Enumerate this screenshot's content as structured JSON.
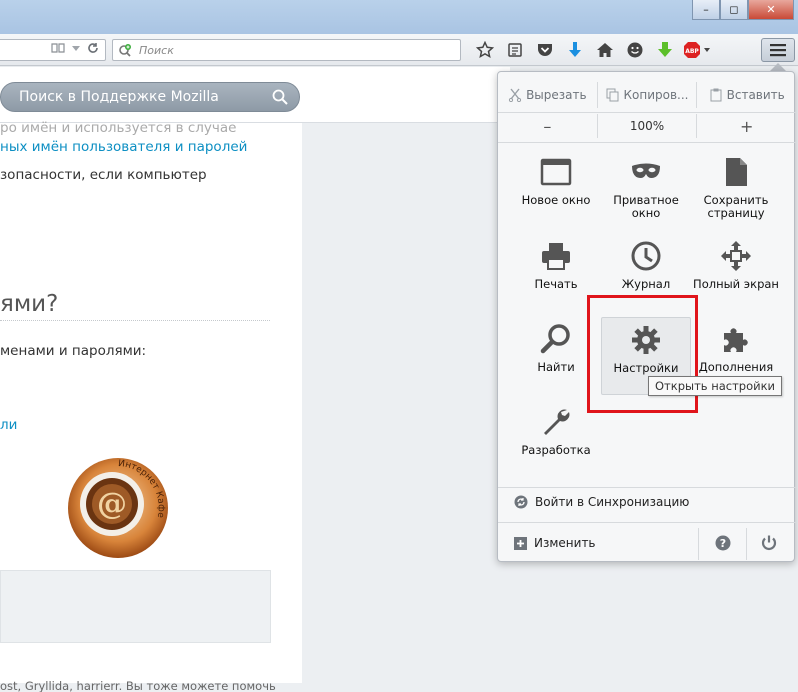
{
  "browser": {
    "search_placeholder": "Поиск",
    "window_buttons": {
      "minimize": "–",
      "maximize": "◻",
      "close": "✕"
    }
  },
  "page": {
    "support_search_placeholder": "Поиск в Поддержке Mozilla",
    "line1": "ро имён и используется в случае",
    "line2_link": "ных имён пользователя и паролей",
    "line3": "зопасности, если компьютер",
    "heading": "ями?",
    "line4": "менами и паролями:",
    "line5_link": "ли",
    "coffee_text": "Интернет Кафе",
    "contributors": "ost, Gryllida, harrierr. Вы тоже можете помочь"
  },
  "menu": {
    "edit": {
      "cut": "Вырезать",
      "copy": "Копиров...",
      "paste": "Вставить"
    },
    "zoom": {
      "minus": "–",
      "level": "100%",
      "plus": "+"
    },
    "items": [
      {
        "label": "Новое окно",
        "icon": "new-window-icon"
      },
      {
        "label": "Приватное окно",
        "icon": "private-mask-icon"
      },
      {
        "label": "Сохранить страницу",
        "icon": "save-page-icon"
      },
      {
        "label": "Печать",
        "icon": "printer-icon"
      },
      {
        "label": "Журнал",
        "icon": "clock-icon"
      },
      {
        "label": "Полный экран",
        "icon": "fullscreen-icon"
      },
      {
        "label": "Найти",
        "icon": "magnifier-icon"
      },
      {
        "label": "Настройки",
        "icon": "gear-icon"
      },
      {
        "label": "Дополнения",
        "icon": "puzzle-icon"
      },
      {
        "label": "Разработка",
        "icon": "wrench-icon"
      }
    ],
    "sync": "Войти в Синхронизацию",
    "customize": "Изменить",
    "tooltip": "Открыть настройки"
  },
  "colors": {
    "highlight": "#e0151b",
    "link": "#0d8fc3"
  }
}
